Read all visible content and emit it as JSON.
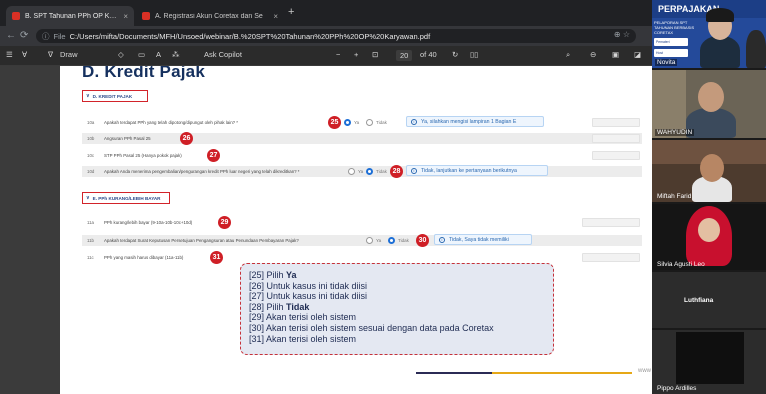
{
  "browser": {
    "tabs": [
      {
        "title": "B. SPT Tahunan PPh OP Karyawan",
        "active": true
      },
      {
        "title": "A. Registrasi Akun Coretax dan Se",
        "active": false
      }
    ],
    "new_tab_symbol": "+",
    "close_symbol": "×",
    "address": {
      "scheme": "File",
      "url": "C:/Users/mifta/Documents/MFH/Unsoed/webinar/B.%20SPT%20Tahunan%20PPh%20OP%20Karyawan.pdf"
    }
  },
  "pdf_toolbar": {
    "draw_label": "Draw",
    "ask_copilot_label": "Ask Copilot",
    "zoom_out": "−",
    "zoom_in": "+",
    "page_current": "20",
    "page_total": "of 40"
  },
  "document": {
    "page_title": "D. Kredit Pajak",
    "section_d": {
      "header": "D. KREDIT PAJAK",
      "rows": [
        {
          "code": "10a",
          "question": "Apakah terdapat PPh yang telah dipotong/dipungut oleh pihak lain? *",
          "badge": "25",
          "yes_label": "Ya",
          "no_label": "Tidak",
          "info": "Ya, silahkan mengisi lampiran 1 Bagian E"
        },
        {
          "code": "10b",
          "question": "Angsuran PPh Pasal 25",
          "badge": "26"
        },
        {
          "code": "10c",
          "question": "STP PPh Pasal 25 (Hanya pokok pajak)",
          "badge": "27"
        },
        {
          "code": "10d",
          "question": "Apakah Anda menerima pengembalian/pengurangan kredit PPh luar negeri yang telah dikreditkan? *",
          "badge": "28",
          "yes_label": "Ya",
          "no_label": "Tidak",
          "info": "Tidak, lanjutkan ke pertanyaan berikutnya"
        }
      ]
    },
    "section_e": {
      "header": "E. PPh KURANG/LEBIH BAYAR",
      "rows": [
        {
          "code": "11a",
          "question": "PPh kurang/lebih bayar (9-10a-10b-10c+10d)",
          "badge": "29"
        },
        {
          "code": "11b",
          "question": "Apakah terdapat Surat Keputusan Persetujuan Pengangsuran atau Penundaan Pembayaran Pajak?",
          "badge": "30",
          "yes_label": "Ya",
          "no_label": "Tidak",
          "info": "Tidak, Saya tidak memiliki"
        },
        {
          "code": "11c",
          "question": "PPh yang masih harus dibayar (11a-11b)",
          "badge": "31"
        }
      ]
    },
    "annotation_lines": [
      {
        "prefix": "[25] Pilih ",
        "bold": "Ya"
      },
      {
        "prefix": "[26] Untuk kasus ini tidak diisi",
        "bold": ""
      },
      {
        "prefix": "[27] Untuk kasus ini tidak diisi",
        "bold": ""
      },
      {
        "prefix": "[28] Pilih ",
        "bold": "Tidak"
      },
      {
        "prefix": "[29] Akan terisi oleh sistem",
        "bold": ""
      },
      {
        "prefix": "[30] Akan terisi oleh sistem sesuai dengan data pada Coretax",
        "bold": ""
      },
      {
        "prefix": "[31] Akan terisi oleh sistem",
        "bold": ""
      }
    ],
    "footer_text": "www"
  },
  "meeting": {
    "slide_heading": "PERPAJAKAN",
    "slide_subtitle": "PELAPORAN SPT TAHUNAN BERBASIS CORETAX",
    "slide_items": [
      "Pemateri",
      "Host"
    ],
    "participants": [
      "Novita",
      "WAHYUDIN",
      "Miftah Farid",
      "Silvia Agusti Leo",
      "Luthfiana",
      "Pippo Ardilles"
    ]
  },
  "colors": {
    "badge_red": "#cf1f26",
    "section_border": "#d2232a",
    "info_blue": "#2a68b0",
    "title_navy": "#15305e",
    "progress_gold": "#e6a817"
  }
}
